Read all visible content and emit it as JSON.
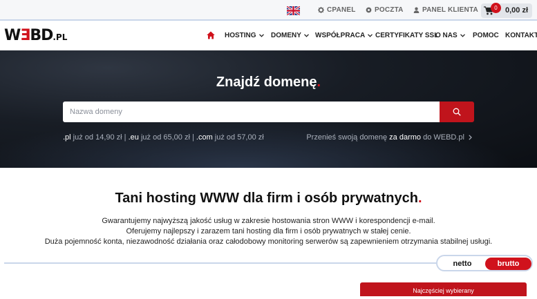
{
  "topbar": {
    "language_flag": "uk-flag-icon",
    "links": [
      {
        "label": "CPANEL",
        "icon": "gear-icon"
      },
      {
        "label": "POCZTA",
        "icon": "at-icon"
      },
      {
        "label": "PANEL KLIENTA",
        "icon": "user-icon"
      }
    ],
    "cart": {
      "icon": "cart-icon",
      "count": "0",
      "total": "0,00 zł"
    }
  },
  "nav": {
    "logo": {
      "part1": "W",
      "part2": "Ǝ",
      "part3": "BD",
      "suffix": ".PL"
    },
    "home_icon": "home-icon",
    "items": [
      {
        "label": "HOSTING",
        "dropdown": true
      },
      {
        "label": "DOMENY",
        "dropdown": true
      },
      {
        "label": "WSPÓŁPRACA",
        "dropdown": true
      },
      {
        "label": "CERTYFIKATY SSL",
        "dropdown": false
      },
      {
        "label": "O NAS",
        "dropdown": true
      },
      {
        "label": "POMOC",
        "dropdown": false
      },
      {
        "label": "KONTAKT",
        "dropdown": false
      }
    ]
  },
  "hero": {
    "title": "Znajdź domenę",
    "title_dot": ".",
    "search_placeholder": "Nazwa domeny",
    "search_icon": "search-icon",
    "prices": [
      {
        "tld": ".pl",
        "text": " już od 14,90 zł"
      },
      {
        "tld": ".eu",
        "text": " już od 65,00 zł"
      },
      {
        "tld": ".com",
        "text": " już od 57,00 zł"
      }
    ],
    "separator": " | ",
    "transfer": {
      "pre": "Przenieś swoją domenę ",
      "bold": "za darmo",
      "post": " do WEBD.pl",
      "icon": "chevron-right-icon"
    }
  },
  "content": {
    "headline": "Tani hosting WWW dla firm i osób prywatnych",
    "headline_dot": ".",
    "lines": [
      "Gwarantujemy najwyższą jakość usług w zakresie hostowania stron WWW i korespondencji e-mail.",
      "Oferujemy najlepszy i zarazem tani hosting dla firm i osób prywatnych w stałej cenie.",
      "Duża pojemność konta, niezawodność działania oraz całodobowy monitoring serwerów są zapewnieniem otrzymania stabilnej usługi."
    ],
    "toggle": {
      "netto": "netto",
      "brutto": "brutto",
      "selected": "brutto"
    },
    "plan_badge": "Najczęściej wybierany"
  },
  "colors": {
    "accent": "#d0121c",
    "hero_bg": "#12161c",
    "divider": "#c9d6ea"
  }
}
